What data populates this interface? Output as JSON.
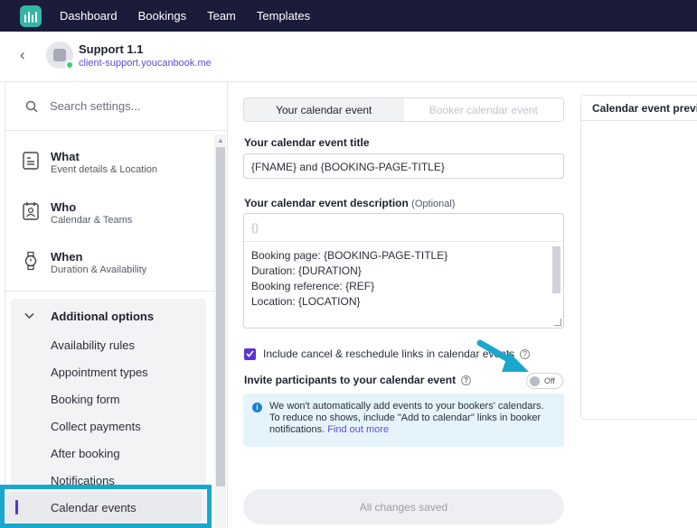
{
  "nav": {
    "items": [
      "Dashboard",
      "Bookings",
      "Team",
      "Templates"
    ]
  },
  "header": {
    "title": "Support 1.1",
    "url": "client-support.youcanbook.me"
  },
  "sidebar": {
    "search_placeholder": "Search settings...",
    "sections": [
      {
        "title": "What",
        "subtitle": "Event details & Location"
      },
      {
        "title": "Who",
        "subtitle": "Calendar & Teams"
      },
      {
        "title": "When",
        "subtitle": "Duration & Availability"
      }
    ],
    "additional": {
      "title": "Additional options",
      "items": [
        "Availability rules",
        "Appointment types",
        "Booking form",
        "Collect payments",
        "After booking",
        "Notifications",
        "Calendar events"
      ]
    }
  },
  "main": {
    "tabs": [
      "Your calendar event",
      "Booker calendar event"
    ],
    "title_label": "Your calendar event title",
    "title_value": "{FNAME} and {BOOKING-PAGE-TITLE}",
    "desc_label": "Your calendar event description",
    "desc_optional": "(Optional)",
    "desc_toolbar": "{}",
    "desc_body": "Booking page: {BOOKING-PAGE-TITLE}\nDuration: {DURATION}\nBooking reference: {REF}\nLocation: {LOCATION}\n\n{FORMFIELDS}",
    "checkbox_label": "Include cancel & reschedule links in calendar events",
    "invite_label": "Invite participants to your calendar event",
    "toggle_state": "Off",
    "info_text": "We won't automatically add events to your bookers' calendars. To reduce no shows, include \"Add to calendar\" links in booker notifications.",
    "info_link": "Find out more",
    "save_label": "All changes saved"
  },
  "preview": {
    "title": "Calendar event preview"
  },
  "colors": {
    "nav_bg": "#1a1c3a",
    "accent": "#5a33d6",
    "highlight": "#1aa7cc",
    "info_bg": "#e4f4fa"
  }
}
